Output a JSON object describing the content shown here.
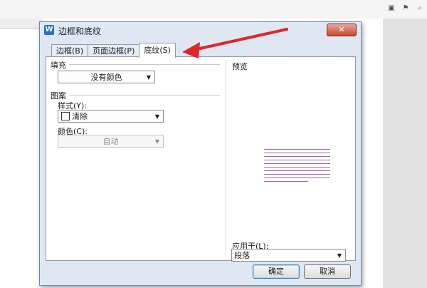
{
  "dialog": {
    "title": "边框和底纹",
    "app_icon": "W",
    "close_label": "✕"
  },
  "tabs": [
    {
      "label": "边框(B)"
    },
    {
      "label": "页面边框(P)"
    },
    {
      "label": "底纹(S)",
      "active": true
    }
  ],
  "shading": {
    "fill_heading": "填充",
    "fill_value": "没有颜色",
    "pattern_heading": "图案",
    "style_label": "样式(Y):",
    "style_value": "清除",
    "color_label": "颜色(C):",
    "color_value": "自动"
  },
  "preview": {
    "heading": "预览",
    "apply_label": "应用于(L):",
    "apply_value": "段落"
  },
  "buttons": {
    "ok": "确定",
    "cancel": "取消"
  },
  "colors": {
    "annotation_arrow": "#e0262a",
    "preview_lines": "#9b6aa1"
  }
}
